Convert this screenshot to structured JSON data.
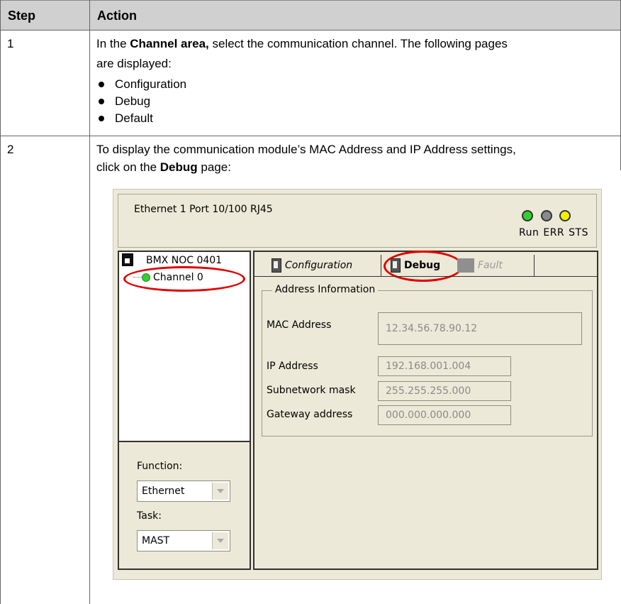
{
  "table": {
    "header": {
      "step": "Step",
      "action": "Action"
    },
    "rows": [
      {
        "step": "1",
        "text_pre": "In the ",
        "text_bold": "Channel area,",
        "text_post": " select the communication channel. The following pages",
        "text_line2": "are displayed:",
        "bullets": [
          "Configuration",
          "Debug",
          "Default"
        ]
      },
      {
        "step": "2",
        "text_line1": "To display the communication module’s MAC Address and IP Address settings,",
        "text_line2_pre": "click on the ",
        "text_line2_bold": "Debug",
        "text_line2_post": " page:"
      }
    ]
  },
  "screenshot": {
    "port_title": "Ethernet 1 Port  10/100 RJ45",
    "leds": [
      {
        "label": "Run",
        "color": "#2fd12f"
      },
      {
        "label": "ERR",
        "color": "#8a8a8a"
      },
      {
        "label": "STS",
        "color": "#f4f000"
      }
    ],
    "tree": {
      "module": "BMX NOC 0401",
      "channel": "Channel 0"
    },
    "function_label": "Function:",
    "function_value": "Ethernet",
    "task_label": "Task:",
    "task_value": "MAST",
    "tabs": {
      "configuration": "Configuration",
      "debug": "Debug",
      "fault": "Fault"
    },
    "address_group_title": "Address Information",
    "mac_label": "MAC Address",
    "mac_value": "12.34.56.78.90.12",
    "ip_label": "IP Address",
    "ip_value": "192.168.001.004",
    "subnet_label": "Subnetwork mask",
    "subnet_value": "255.255.255.000",
    "gateway_label": "Gateway address",
    "gateway_value": "000.000.000.000",
    "highlight_color": "#e00000"
  }
}
